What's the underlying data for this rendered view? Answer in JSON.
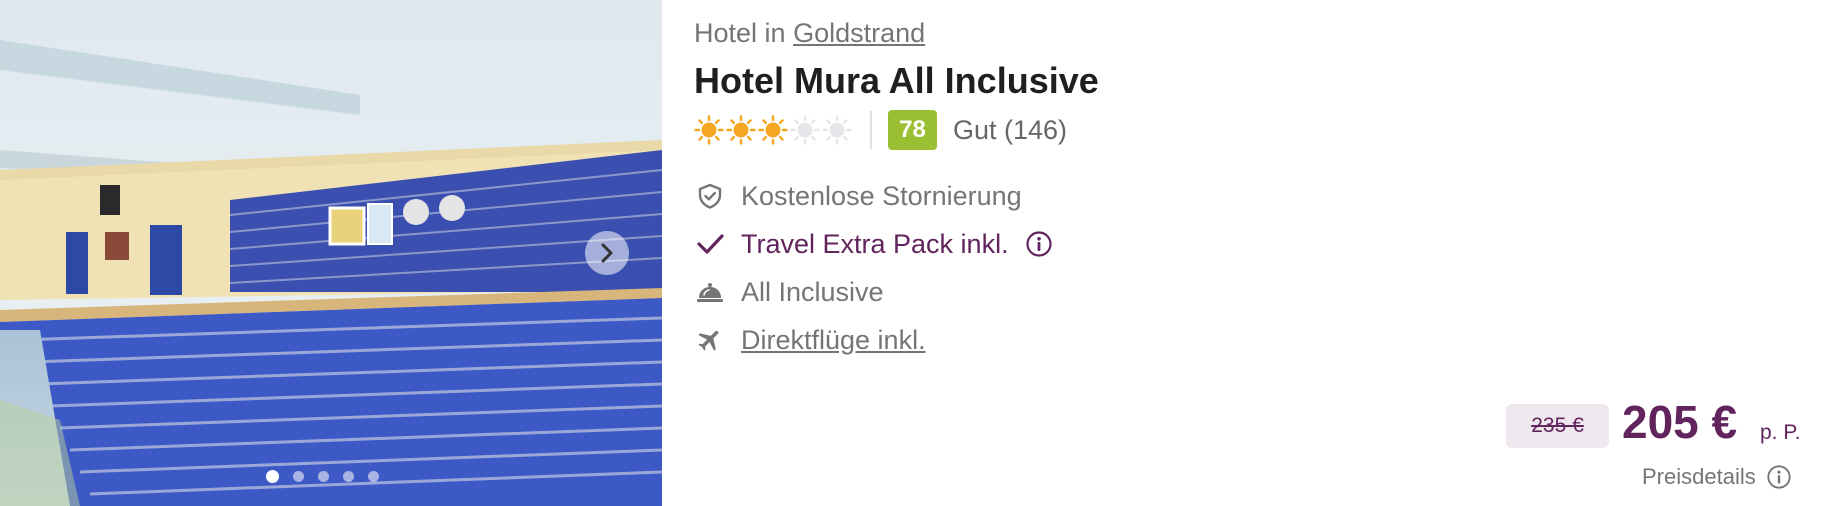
{
  "location": {
    "prefix": "Hotel in",
    "city": "Goldstrand"
  },
  "hotel_name": "Hotel Mura All Inclusive",
  "stars": {
    "filled": 3,
    "total": 5
  },
  "rating": {
    "score": "78",
    "label": "Gut (146)"
  },
  "features": [
    {
      "icon": "shield-check-icon",
      "label": "Kostenlose Stornierung"
    },
    {
      "icon": "checkmark-icon",
      "label": "Travel Extra Pack inkl."
    },
    {
      "icon": "cloche-icon",
      "label": "All Inclusive"
    },
    {
      "icon": "plane-icon",
      "label": "Direktflüge inkl."
    }
  ],
  "price": {
    "old": "235 €",
    "current": "205 €",
    "unit": "p. P.",
    "details_label": "Preisdetails"
  },
  "gallery": {
    "image_count": 5,
    "active_index": 0
  },
  "colors": {
    "accent": "#62245c",
    "score_badge": "#9bbf32",
    "stars": "#f5a623",
    "muted_text": "#757575"
  }
}
